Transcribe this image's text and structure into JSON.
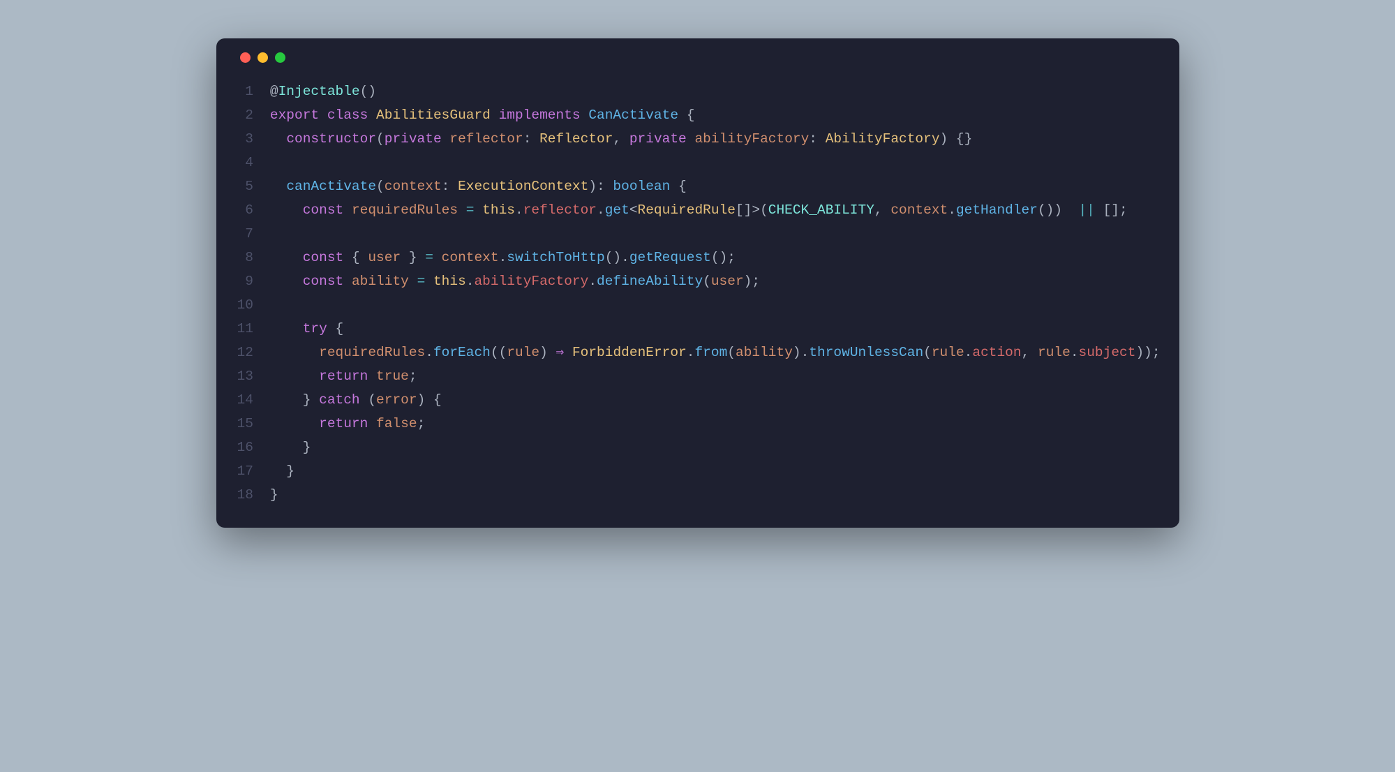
{
  "editor": {
    "lineNumbers": [
      "1",
      "2",
      "3",
      "4",
      "5",
      "6",
      "7",
      "8",
      "9",
      "10",
      "11",
      "12",
      "13",
      "14",
      "15",
      "16",
      "17",
      "18"
    ],
    "lines": {
      "l1": [
        {
          "t": "@",
          "c": "tk-punct"
        },
        {
          "t": "Injectable",
          "c": "tk-decorator"
        },
        {
          "t": "()",
          "c": "tk-punct"
        }
      ],
      "l2": [
        {
          "t": "export",
          "c": "tk-keyword"
        },
        {
          "t": " ",
          "c": "tk-plain"
        },
        {
          "t": "class",
          "c": "tk-keyword"
        },
        {
          "t": " ",
          "c": "tk-plain"
        },
        {
          "t": "AbilitiesGuard",
          "c": "tk-class-name"
        },
        {
          "t": " ",
          "c": "tk-plain"
        },
        {
          "t": "implements",
          "c": "tk-keyword"
        },
        {
          "t": " ",
          "c": "tk-plain"
        },
        {
          "t": "CanActivate",
          "c": "tk-method"
        },
        {
          "t": " {",
          "c": "tk-punct"
        }
      ],
      "l3": [
        {
          "t": "  ",
          "c": "tk-plain"
        },
        {
          "t": "constructor",
          "c": "tk-keyword"
        },
        {
          "t": "(",
          "c": "tk-punct"
        },
        {
          "t": "private",
          "c": "tk-keyword"
        },
        {
          "t": " ",
          "c": "tk-plain"
        },
        {
          "t": "reflector",
          "c": "tk-param"
        },
        {
          "t": ": ",
          "c": "tk-punct"
        },
        {
          "t": "Reflector",
          "c": "tk-type"
        },
        {
          "t": ", ",
          "c": "tk-punct"
        },
        {
          "t": "private",
          "c": "tk-keyword"
        },
        {
          "t": " ",
          "c": "tk-plain"
        },
        {
          "t": "abilityFactory",
          "c": "tk-param"
        },
        {
          "t": ": ",
          "c": "tk-punct"
        },
        {
          "t": "AbilityFactory",
          "c": "tk-type"
        },
        {
          "t": ") {}",
          "c": "tk-punct"
        }
      ],
      "l4": [],
      "l5": [
        {
          "t": "  ",
          "c": "tk-plain"
        },
        {
          "t": "canActivate",
          "c": "tk-method"
        },
        {
          "t": "(",
          "c": "tk-punct"
        },
        {
          "t": "context",
          "c": "tk-param"
        },
        {
          "t": ": ",
          "c": "tk-punct"
        },
        {
          "t": "ExecutionContext",
          "c": "tk-type"
        },
        {
          "t": ")",
          "c": "tk-punct"
        },
        {
          "t": ": ",
          "c": "tk-punct"
        },
        {
          "t": "boolean",
          "c": "tk-method"
        },
        {
          "t": " {",
          "c": "tk-punct"
        }
      ],
      "l6": [
        {
          "t": "    ",
          "c": "tk-plain"
        },
        {
          "t": "const",
          "c": "tk-keyword"
        },
        {
          "t": " ",
          "c": "tk-plain"
        },
        {
          "t": "requiredRules",
          "c": "tk-const"
        },
        {
          "t": " ",
          "c": "tk-plain"
        },
        {
          "t": "=",
          "c": "tk-op"
        },
        {
          "t": " ",
          "c": "tk-plain"
        },
        {
          "t": "this",
          "c": "tk-this"
        },
        {
          "t": ".",
          "c": "tk-punct"
        },
        {
          "t": "reflector",
          "c": "tk-prop"
        },
        {
          "t": ".",
          "c": "tk-punct"
        },
        {
          "t": "get",
          "c": "tk-call"
        },
        {
          "t": "<",
          "c": "tk-punct"
        },
        {
          "t": "RequiredRule",
          "c": "tk-type"
        },
        {
          "t": "[]>(",
          "c": "tk-punct"
        },
        {
          "t": "CHECK_ABILITY",
          "c": "tk-decorator"
        },
        {
          "t": ", ",
          "c": "tk-punct"
        },
        {
          "t": "context",
          "c": "tk-const"
        },
        {
          "t": ".",
          "c": "tk-punct"
        },
        {
          "t": "getHandler",
          "c": "tk-call"
        },
        {
          "t": "())  ",
          "c": "tk-punct"
        },
        {
          "t": "||",
          "c": "tk-op"
        },
        {
          "t": " [];",
          "c": "tk-punct"
        }
      ],
      "l7": [],
      "l8": [
        {
          "t": "    ",
          "c": "tk-plain"
        },
        {
          "t": "const",
          "c": "tk-keyword"
        },
        {
          "t": " { ",
          "c": "tk-punct"
        },
        {
          "t": "user",
          "c": "tk-const"
        },
        {
          "t": " } ",
          "c": "tk-punct"
        },
        {
          "t": "=",
          "c": "tk-op"
        },
        {
          "t": " ",
          "c": "tk-plain"
        },
        {
          "t": "context",
          "c": "tk-const"
        },
        {
          "t": ".",
          "c": "tk-punct"
        },
        {
          "t": "switchToHttp",
          "c": "tk-call"
        },
        {
          "t": "().",
          "c": "tk-punct"
        },
        {
          "t": "getRequest",
          "c": "tk-call"
        },
        {
          "t": "();",
          "c": "tk-punct"
        }
      ],
      "l9": [
        {
          "t": "    ",
          "c": "tk-plain"
        },
        {
          "t": "const",
          "c": "tk-keyword"
        },
        {
          "t": " ",
          "c": "tk-plain"
        },
        {
          "t": "ability",
          "c": "tk-const"
        },
        {
          "t": " ",
          "c": "tk-plain"
        },
        {
          "t": "=",
          "c": "tk-op"
        },
        {
          "t": " ",
          "c": "tk-plain"
        },
        {
          "t": "this",
          "c": "tk-this"
        },
        {
          "t": ".",
          "c": "tk-punct"
        },
        {
          "t": "abilityFactory",
          "c": "tk-prop"
        },
        {
          "t": ".",
          "c": "tk-punct"
        },
        {
          "t": "defineAbility",
          "c": "tk-call"
        },
        {
          "t": "(",
          "c": "tk-punct"
        },
        {
          "t": "user",
          "c": "tk-const"
        },
        {
          "t": ");",
          "c": "tk-punct"
        }
      ],
      "l10": [],
      "l11": [
        {
          "t": "    ",
          "c": "tk-plain"
        },
        {
          "t": "try",
          "c": "tk-keyword"
        },
        {
          "t": " {",
          "c": "tk-punct"
        }
      ],
      "l12": [
        {
          "t": "      ",
          "c": "tk-plain"
        },
        {
          "t": "requiredRules",
          "c": "tk-const"
        },
        {
          "t": ".",
          "c": "tk-punct"
        },
        {
          "t": "forEach",
          "c": "tk-call"
        },
        {
          "t": "((",
          "c": "tk-punct"
        },
        {
          "t": "rule",
          "c": "tk-param"
        },
        {
          "t": ") ",
          "c": "tk-punct"
        },
        {
          "t": "⇒",
          "c": "tk-arrow"
        },
        {
          "t": " ",
          "c": "tk-plain"
        },
        {
          "t": "ForbiddenError",
          "c": "tk-type"
        },
        {
          "t": ".",
          "c": "tk-punct"
        },
        {
          "t": "from",
          "c": "tk-call"
        },
        {
          "t": "(",
          "c": "tk-punct"
        },
        {
          "t": "ability",
          "c": "tk-const"
        },
        {
          "t": ").",
          "c": "tk-punct"
        },
        {
          "t": "throwUnlessCan",
          "c": "tk-call"
        },
        {
          "t": "(",
          "c": "tk-punct"
        },
        {
          "t": "rule",
          "c": "tk-const"
        },
        {
          "t": ".",
          "c": "tk-punct"
        },
        {
          "t": "action",
          "c": "tk-prop"
        },
        {
          "t": ", ",
          "c": "tk-punct"
        },
        {
          "t": "rule",
          "c": "tk-const"
        },
        {
          "t": ".",
          "c": "tk-punct"
        },
        {
          "t": "subject",
          "c": "tk-prop"
        },
        {
          "t": "));",
          "c": "tk-punct"
        }
      ],
      "l13": [
        {
          "t": "      ",
          "c": "tk-plain"
        },
        {
          "t": "return",
          "c": "tk-keyword"
        },
        {
          "t": " ",
          "c": "tk-plain"
        },
        {
          "t": "true",
          "c": "tk-bool"
        },
        {
          "t": ";",
          "c": "tk-punct"
        }
      ],
      "l14": [
        {
          "t": "    } ",
          "c": "tk-punct"
        },
        {
          "t": "catch",
          "c": "tk-keyword"
        },
        {
          "t": " (",
          "c": "tk-punct"
        },
        {
          "t": "error",
          "c": "tk-param"
        },
        {
          "t": ") {",
          "c": "tk-punct"
        }
      ],
      "l15": [
        {
          "t": "      ",
          "c": "tk-plain"
        },
        {
          "t": "return",
          "c": "tk-keyword"
        },
        {
          "t": " ",
          "c": "tk-plain"
        },
        {
          "t": "false",
          "c": "tk-bool"
        },
        {
          "t": ";",
          "c": "tk-punct"
        }
      ],
      "l16": [
        {
          "t": "    }",
          "c": "tk-punct"
        }
      ],
      "l17": [
        {
          "t": "  }",
          "c": "tk-punct"
        }
      ],
      "l18": [
        {
          "t": "}",
          "c": "tk-punct"
        }
      ]
    }
  }
}
